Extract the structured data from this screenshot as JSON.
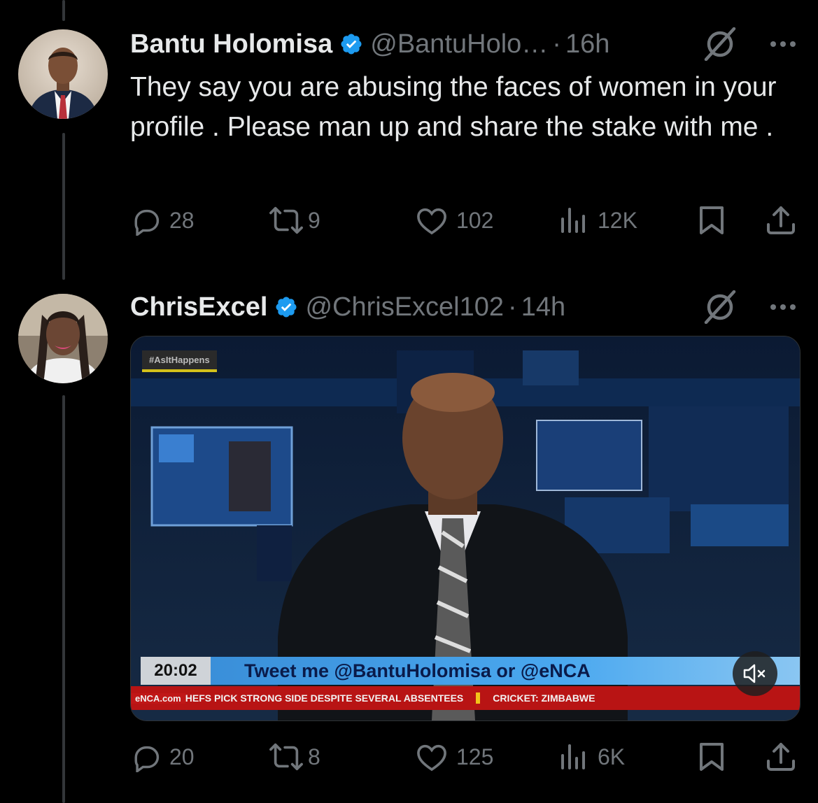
{
  "tweets": [
    {
      "name": "Bantu Holomisa",
      "handle": "@BantuHolo…",
      "separator": "·",
      "time": "16h",
      "text": "They say you are abusing the faces of women in your profile . Please man up and share the stake with me .",
      "replies": "28",
      "reposts": "9",
      "likes": "102",
      "views": "12K",
      "avatar_icon": "portrait-man-suit"
    },
    {
      "name": "ChrisExcel",
      "handle": "@ChrisExcel102",
      "separator": "·",
      "time": "14h",
      "text": "",
      "replies": "20",
      "reposts": "8",
      "likes": "125",
      "views": "6K",
      "avatar_icon": "portrait-woman-braids",
      "media": {
        "hashtag": "#AsItHappens",
        "clock": "20:02",
        "banner": "Tweet me @BantuHolomisa or @eNCA",
        "ticker_brand": "eNCA.com",
        "ticker_1": "HEFS PICK STRONG SIDE DESPITE SEVERAL ABSENTEES",
        "ticker_2": "CRICKET: ZIMBABWE",
        "mute_icon": "speaker-muted-icon"
      }
    }
  ],
  "colors": {
    "background": "#000000",
    "text": "#e7e9ea",
    "muted": "#71767b",
    "verified": "#1d9bf0",
    "thread_line": "#333639"
  }
}
